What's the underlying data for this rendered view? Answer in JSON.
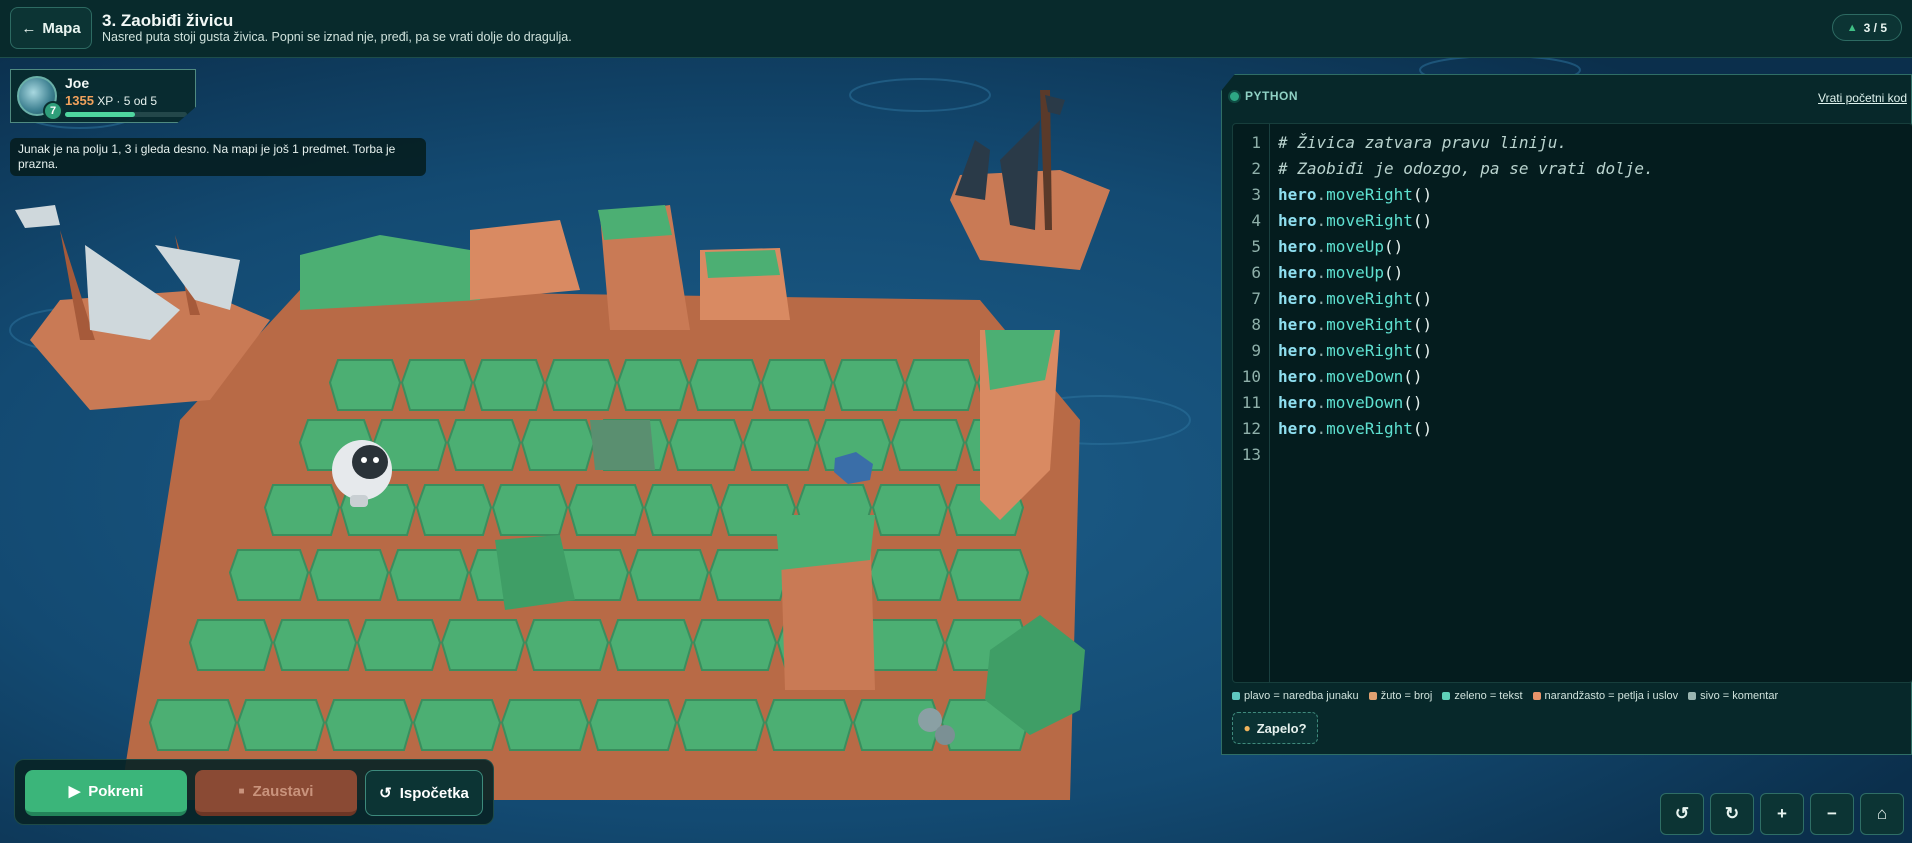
{
  "header": {
    "back_label": "Mapa",
    "back_arrow": "←",
    "title": "3. Zaobiđi živicu",
    "subtitle": "Nasred puta stoji gusta živica. Popni se iznad nje, pređi, pa se vrati dolje do dragulja.",
    "progress": "3 / 5",
    "progress_icon": "tree-icon"
  },
  "player": {
    "name": "Joe",
    "level": "7",
    "xp_value": "1355",
    "xp_unit": "XP",
    "stage": "· 5 od 5",
    "xp_progress": 0.57
  },
  "status_message": "Junak je na polju 1, 3 i gleda desno. Na mapi je još 1 predmet. Torba je prazna.",
  "controls": {
    "run_label": "Pokreni",
    "stop_label": "Zaustavi",
    "restart_label": "Ispočetka",
    "run_icon": "play-icon",
    "stop_icon": "stop-icon",
    "restart_icon": "restart-icon"
  },
  "code_panel": {
    "language": "PYTHON",
    "reset_label": "Vrati početni kod",
    "lines": [
      "# Živica zatvara pravu liniju.",
      "# Zaobiđi je odozgo, pa se vrati dolje.",
      "hero.moveRight()",
      "hero.moveRight()",
      "hero.moveUp()",
      "hero.moveUp()",
      "hero.moveRight()",
      "hero.moveRight()",
      "hero.moveRight()",
      "hero.moveDown()",
      "hero.moveDown()",
      "hero.moveRight()",
      ""
    ],
    "legend": [
      {
        "label": "plavo = naredba junaku",
        "color": "#5ec8c0"
      },
      {
        "label": "žuto = broj",
        "color": "#e0a070"
      },
      {
        "label": "zeleno = tekst",
        "color": "#5ed0b8"
      },
      {
        "label": "narandžasto = petlja i uslov",
        "color": "#e8946a"
      },
      {
        "label": "sivo = komentar",
        "color": "#9ab5b0"
      }
    ],
    "hint_label": "Zapelo?",
    "hint_icon": "lightbulb-icon"
  },
  "camera": {
    "buttons": [
      {
        "name": "rotate-left-button",
        "icon": "rotate-left-icon",
        "glyph": "↺"
      },
      {
        "name": "rotate-right-button",
        "icon": "rotate-right-icon",
        "glyph": "↻"
      },
      {
        "name": "zoom-in-button",
        "icon": "zoom-in-icon",
        "glyph": "+"
      },
      {
        "name": "zoom-out-button",
        "icon": "zoom-out-icon",
        "glyph": "−"
      },
      {
        "name": "home-view-button",
        "icon": "home-icon",
        "glyph": "⌂"
      }
    ]
  },
  "colors": {
    "water": "#0d3650",
    "grass": "#4caf73",
    "dirt": "#d98a62",
    "accent": "#3bb57a",
    "gem": "#3a6ea8"
  }
}
